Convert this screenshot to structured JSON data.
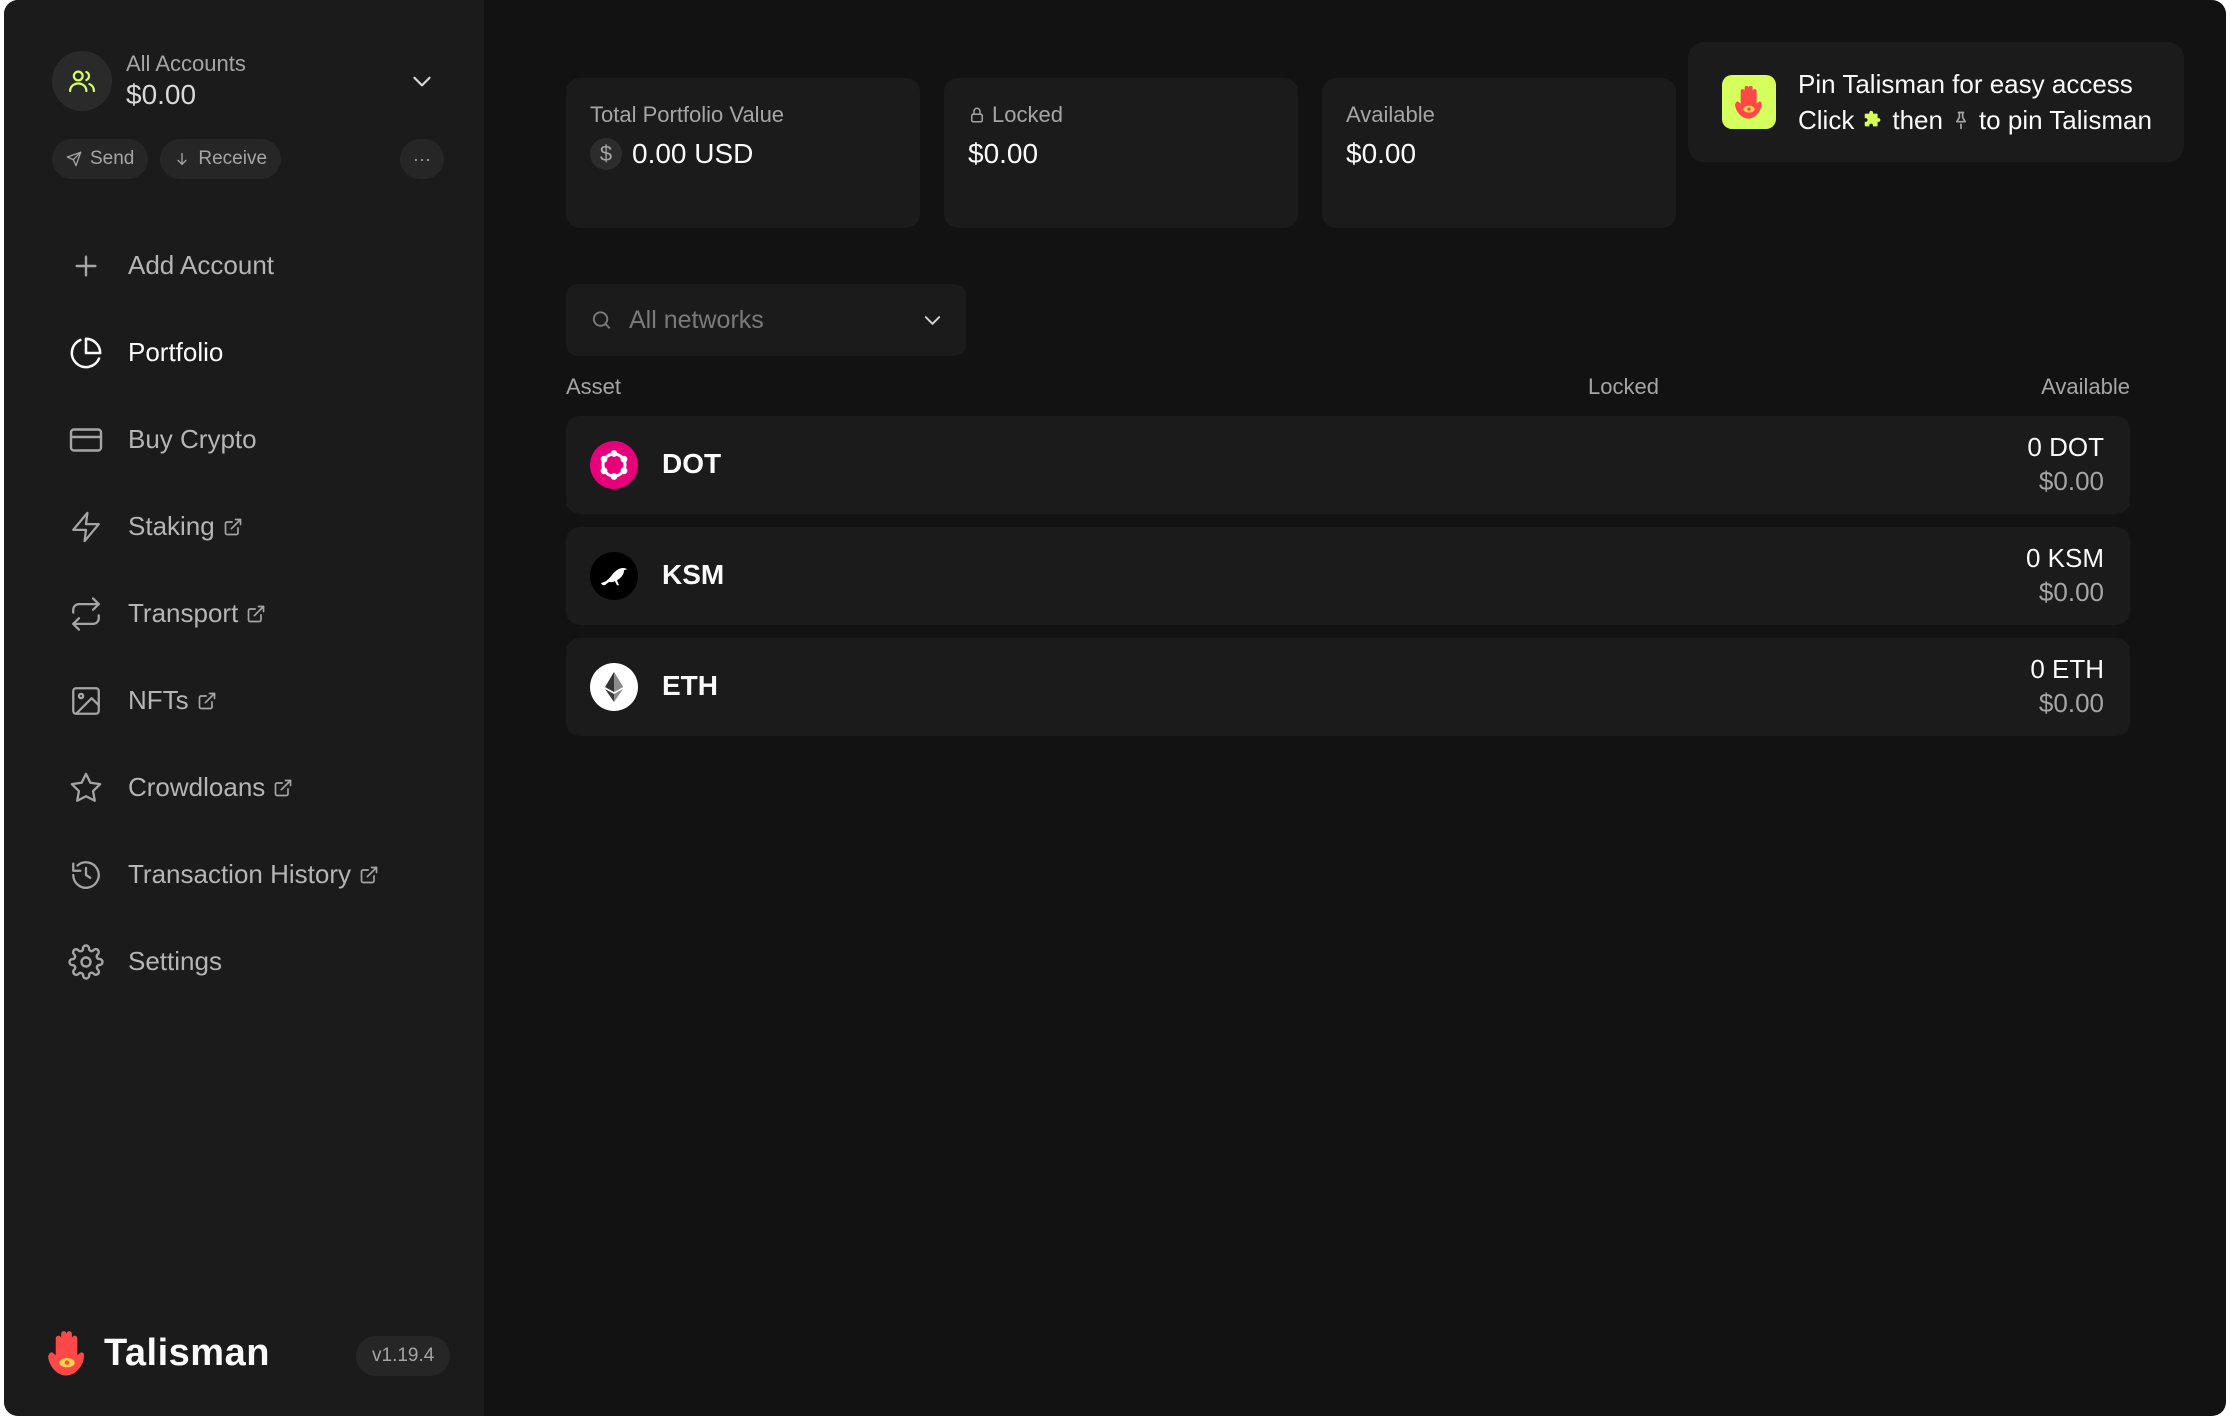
{
  "account": {
    "name": "All Accounts",
    "balance": "$0.00",
    "send_label": "Send",
    "receive_label": "Receive",
    "more_label": "···"
  },
  "nav": [
    {
      "label": "Add Account",
      "icon": "plus-icon",
      "external": false
    },
    {
      "label": "Portfolio",
      "icon": "pie-chart-icon",
      "external": false,
      "active": true
    },
    {
      "label": "Buy Crypto",
      "icon": "credit-card-icon",
      "external": false
    },
    {
      "label": "Staking",
      "icon": "zap-icon",
      "external": true
    },
    {
      "label": "Transport",
      "icon": "repeat-icon",
      "external": true
    },
    {
      "label": "NFTs",
      "icon": "image-icon",
      "external": true
    },
    {
      "label": "Crowdloans",
      "icon": "star-icon",
      "external": true
    },
    {
      "label": "Transaction History",
      "icon": "history-icon",
      "external": true
    },
    {
      "label": "Settings",
      "icon": "settings-icon",
      "external": false
    }
  ],
  "brand": {
    "name": "Talisman",
    "version": "v1.19.4"
  },
  "summary": {
    "total": {
      "label": "Total Portfolio Value",
      "value": "0.00 USD",
      "currency_symbol": "$"
    },
    "locked": {
      "label": "Locked",
      "value": "$0.00"
    },
    "available": {
      "label": "Available",
      "value": "$0.00"
    }
  },
  "pin_tip": {
    "line1": "Pin Talisman for easy access",
    "line2_a": "Click",
    "line2_b": "then",
    "line2_c": "to pin Talisman"
  },
  "filter": {
    "placeholder": "All networks"
  },
  "table": {
    "headers": {
      "asset": "Asset",
      "locked": "Locked",
      "available": "Available"
    },
    "rows": [
      {
        "symbol": "DOT",
        "token_amount": "0 DOT",
        "fiat": "$0.00",
        "color": "#e6007a"
      },
      {
        "symbol": "KSM",
        "token_amount": "0 KSM",
        "fiat": "$0.00",
        "color": "#000000"
      },
      {
        "symbol": "ETH",
        "token_amount": "0 ETH",
        "fiat": "$0.00",
        "color": "#ffffff"
      }
    ]
  },
  "colors": {
    "accent": "#d5ff5c",
    "brand": "#fd4848",
    "background": "#121212",
    "panel": "#1b1b1b"
  }
}
